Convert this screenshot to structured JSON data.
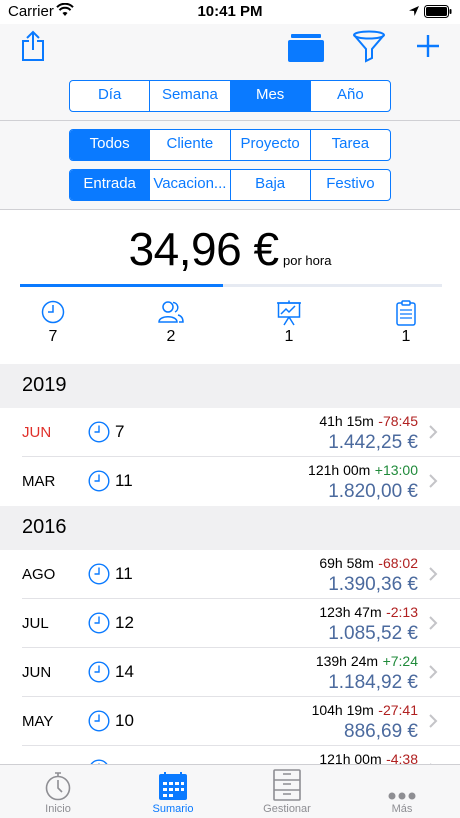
{
  "status": {
    "carrier": "Carrier",
    "time": "10:41 PM"
  },
  "period_tabs": [
    "Día",
    "Semana",
    "Mes",
    "Año"
  ],
  "period_active": 2,
  "scope_tabs": [
    "Todos",
    "Cliente",
    "Proyecto",
    "Tarea"
  ],
  "scope_active": 0,
  "type_tabs": [
    "Entrada",
    "Vacacion...",
    "Baja",
    "Festivo"
  ],
  "type_active": 0,
  "rate": {
    "value": "34,96 €",
    "unit": "por hora",
    "progress_fraction": 0.48
  },
  "stats": [
    {
      "icon": "clock-icon",
      "value": "7"
    },
    {
      "icon": "people-icon",
      "value": "2"
    },
    {
      "icon": "presentation-icon",
      "value": "1"
    },
    {
      "icon": "clipboard-icon",
      "value": "1"
    }
  ],
  "sections": [
    {
      "year": "2019",
      "rows": [
        {
          "month": "JUN",
          "month_color": "#e0302a",
          "count": "7",
          "hours": "41h 15m",
          "diff": "-78:45",
          "diff_color": "#b02020",
          "amount": "1.442,25 €"
        },
        {
          "month": "MAR",
          "month_color": "#000000",
          "count": "11",
          "hours": "121h 00m",
          "diff": "+13:00",
          "diff_color": "#1f8a3a",
          "amount": "1.820,00 €"
        }
      ]
    },
    {
      "year": "2016",
      "rows": [
        {
          "month": "AGO",
          "month_color": "#000000",
          "count": "11",
          "hours": "69h 58m",
          "diff": "-68:02",
          "diff_color": "#b02020",
          "amount": "1.390,36 €"
        },
        {
          "month": "JUL",
          "month_color": "#000000",
          "count": "12",
          "hours": "123h 47m",
          "diff": "-2:13",
          "diff_color": "#b02020",
          "amount": "1.085,52 €"
        },
        {
          "month": "JUN",
          "month_color": "#000000",
          "count": "14",
          "hours": "139h 24m",
          "diff": "+7:24",
          "diff_color": "#1f8a3a",
          "amount": "1.184,92 €"
        },
        {
          "month": "MAY",
          "month_color": "#000000",
          "count": "10",
          "hours": "104h 19m",
          "diff": "-27:41",
          "diff_color": "#b02020",
          "amount": "886,69 €"
        },
        {
          "month": "",
          "month_color": "#000000",
          "count": "",
          "hours": "121h 00m",
          "diff": "-4:38",
          "diff_color": "#b02020",
          "amount": ""
        }
      ]
    }
  ],
  "tabbar": [
    {
      "label": "Inicio",
      "icon": "compass-icon"
    },
    {
      "label": "Sumario",
      "icon": "calendar-icon"
    },
    {
      "label": "Gestionar",
      "icon": "cabinet-icon"
    },
    {
      "label": "Más",
      "icon": "more-icon"
    }
  ],
  "tabbar_active": 1,
  "colors": {
    "accent": "#0a7aff",
    "amount": "#4b6a9e",
    "negative": "#b02020",
    "positive": "#1f8a3a"
  }
}
